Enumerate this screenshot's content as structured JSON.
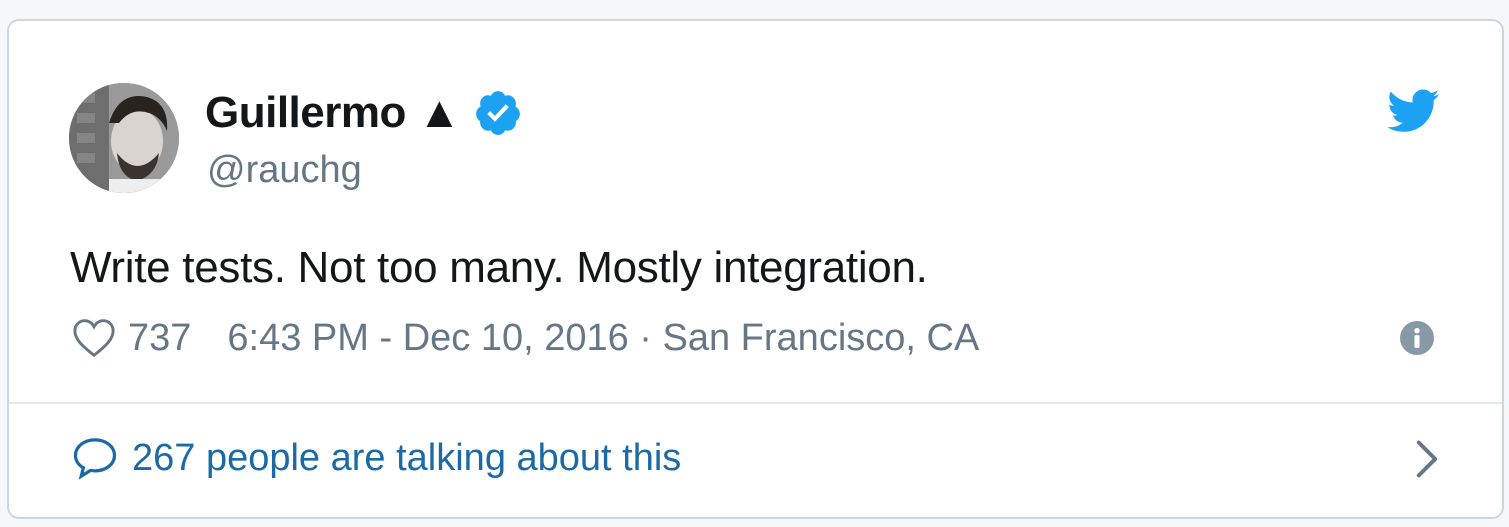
{
  "tweet": {
    "author_name": "Guillermo ▲",
    "handle": "@rauchg",
    "text": "Write tests. Not too many. Mostly integration.",
    "likes": "737",
    "timestamp_location": "6:43 PM - Dec 10, 2016 · San Francisco, CA",
    "conversation_label": "267 people are talking about this"
  },
  "icons": {
    "verified": "verified-badge-icon",
    "brand": "twitter-bird-icon",
    "like": "heart-icon",
    "info": "info-icon",
    "reply": "speech-bubble-icon",
    "chevron": "chevron-right-icon"
  },
  "colors": {
    "twitter_blue": "#1da1f2",
    "text_primary": "#14171a",
    "text_secondary": "#657786",
    "link": "#1b6aa5",
    "border": "#ccd6dd"
  }
}
